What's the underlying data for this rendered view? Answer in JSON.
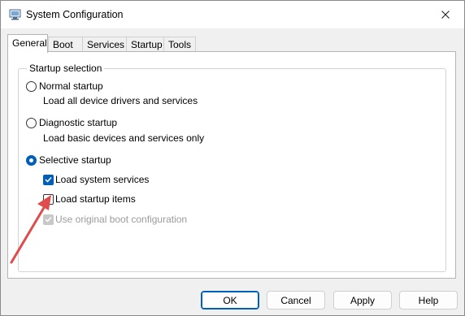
{
  "window": {
    "title": "System Configuration"
  },
  "tabs": [
    {
      "label": "General"
    },
    {
      "label": "Boot"
    },
    {
      "label": "Services"
    },
    {
      "label": "Startup"
    },
    {
      "label": "Tools"
    }
  ],
  "startup_selection": {
    "legend": "Startup selection",
    "normal": {
      "label": "Normal startup",
      "description": "Load all device drivers and services",
      "selected": false
    },
    "diagnostic": {
      "label": "Diagnostic startup",
      "description": "Load basic devices and services only",
      "selected": false
    },
    "selective": {
      "label": "Selective startup",
      "selected": true
    },
    "options": [
      {
        "label": "Load system services",
        "checked": true,
        "enabled": true
      },
      {
        "label": "Load startup items",
        "checked": false,
        "enabled": true
      },
      {
        "label": "Use original boot configuration",
        "checked": true,
        "enabled": false
      }
    ]
  },
  "buttons": {
    "ok": "OK",
    "cancel": "Cancel",
    "apply": "Apply",
    "help": "Help"
  },
  "colors": {
    "accent": "#005fb8",
    "annotation_arrow": "#e04b4b"
  }
}
